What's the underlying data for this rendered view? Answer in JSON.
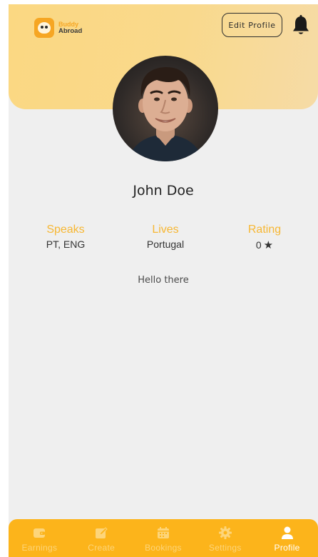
{
  "brand": {
    "line1": "Buddy",
    "line2": "Abroad"
  },
  "header": {
    "edit_label": "Edit Profile"
  },
  "profile": {
    "name": "John Doe",
    "bio": "Hello there",
    "stats": {
      "speaks": {
        "label": "Speaks",
        "value": "PT, ENG"
      },
      "lives": {
        "label": "Lives",
        "value": "Portugal"
      },
      "rating": {
        "label": "Rating",
        "value": "0",
        "icon": "star-icon"
      }
    }
  },
  "nav": {
    "items": [
      {
        "label": "Earnings",
        "icon": "wallet-icon",
        "active": false
      },
      {
        "label": "Create",
        "icon": "edit-icon",
        "active": false
      },
      {
        "label": "Bookings",
        "icon": "calendar-icon",
        "active": false
      },
      {
        "label": "Settings",
        "icon": "gear-icon",
        "active": false
      },
      {
        "label": "Profile",
        "icon": "person-icon",
        "active": true
      }
    ]
  },
  "colors": {
    "accent": "#fcb41b",
    "stat_label": "#f7b733",
    "header_bg": "#fbd882",
    "nav_inactive": "#fdd57a",
    "nav_active": "#ffffff"
  }
}
